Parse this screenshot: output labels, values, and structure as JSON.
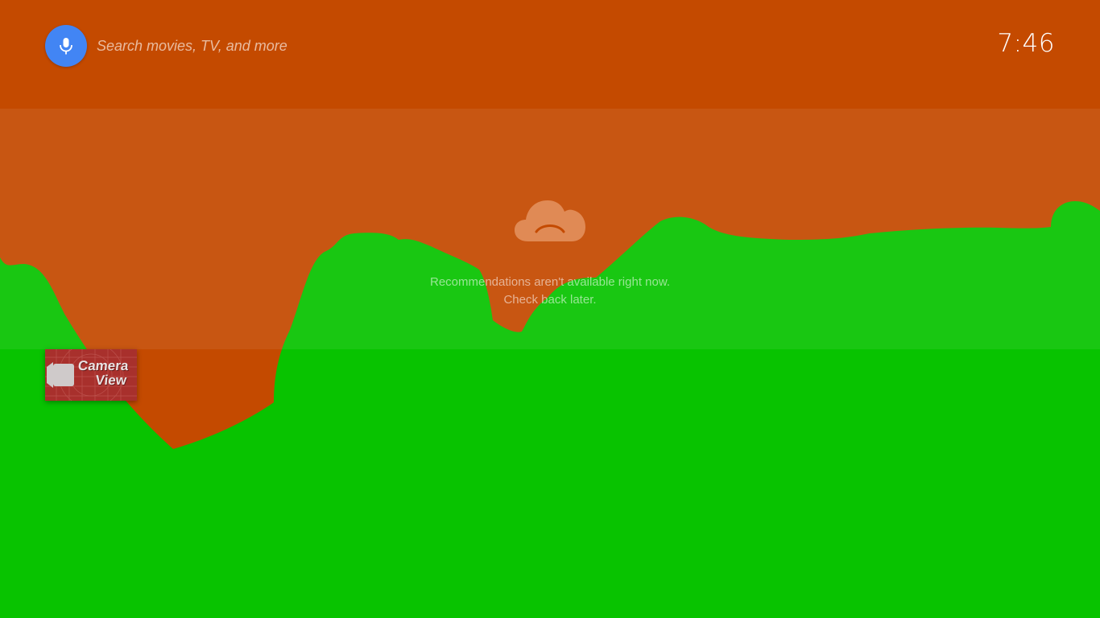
{
  "search": {
    "placeholder": "Search movies, TV, and more",
    "icon": "microphone-icon"
  },
  "clock": {
    "time": "7:46"
  },
  "recommendations": {
    "icon": "sad-cloud-icon",
    "message_line1": "Recommendations aren't available right now.",
    "message_line2": "Check back later."
  },
  "apps": [
    {
      "name": "Camera View",
      "line1": "Camera",
      "line2": "View",
      "icon": "video-camera-icon"
    }
  ],
  "colors": {
    "sky": "#c44a00",
    "grass_light": "#18c413",
    "grass": "#08c300",
    "mic": "#4285f4",
    "tile": "#a8302c"
  }
}
